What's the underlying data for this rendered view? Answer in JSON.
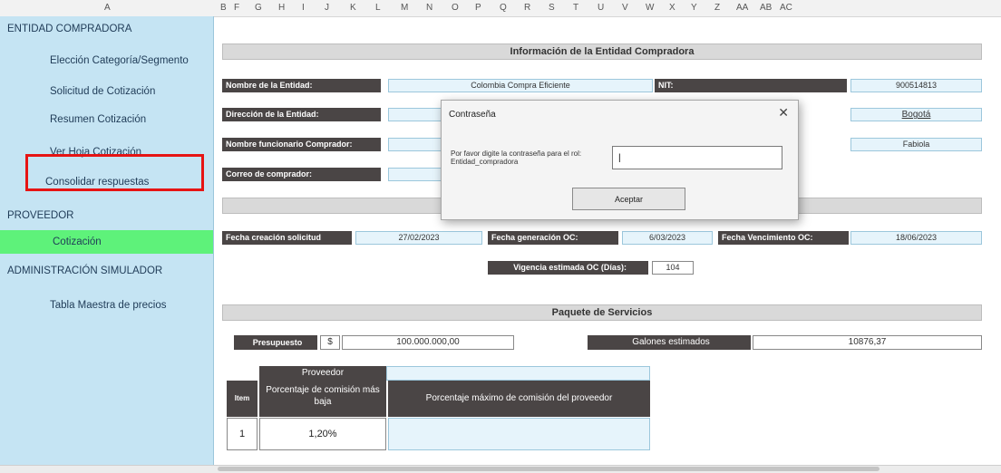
{
  "columns": [
    "A",
    "B",
    "F",
    "G",
    "H",
    "I",
    "J",
    "K",
    "L",
    "M",
    "N",
    "O",
    "P",
    "Q",
    "R",
    "S",
    "T",
    "U",
    "V",
    "W",
    "X",
    "Y",
    "Z",
    "AA",
    "AB",
    "AC"
  ],
  "sidebar": {
    "sections": [
      {
        "title": "ENTIDAD COMPRADORA"
      },
      {
        "title": "PROVEEDOR"
      },
      {
        "title": "ADMINISTRACIÓN SIMULADOR"
      }
    ],
    "items": [
      {
        "label": "Elección Categoría/Segmento"
      },
      {
        "label": "Solicitud de Cotización"
      },
      {
        "label": "Resumen Cotización"
      },
      {
        "label": "Ver Hoja Cotización"
      },
      {
        "label": "Consolidar respuestas"
      },
      {
        "label": "Cotización"
      },
      {
        "label": "Tabla Maestra de precios"
      }
    ]
  },
  "main": {
    "header1": "Información de la Entidad Compradora",
    "nombre_entidad_label": "Nombre de la Entidad:",
    "nombre_entidad_value": "Colombia Compra Eficiente",
    "nit_label": "NIT:",
    "nit_value": "900514813",
    "direccion_label": "Dirección de la Entidad:",
    "ciudad_value": "Bogotá",
    "funcionario_label": "Nombre funcionario Comprador:",
    "funcionario_value": "Fabiola",
    "correo_label": "Correo de comprador:",
    "fecha_creacion_label": "Fecha creación solicitud",
    "fecha_creacion_value": "27/02/2023",
    "fecha_generacion_label": "Fecha generación OC:",
    "fecha_generacion_value": "6/03/2023",
    "fecha_venc_label": "Fecha Vencimiento OC:",
    "fecha_venc_value": "18/06/2023",
    "vigencia_label": "Vigencia estimada OC (Días):",
    "vigencia_value": "104",
    "header2": "Paquete de Servicios",
    "presupuesto_label": "Presupuesto",
    "currency": "$",
    "presupuesto_value": "100.000.000,00",
    "galones_label": "Galones estimados",
    "galones_value": "10876,37"
  },
  "table": {
    "proveedor_header": "Proveedor",
    "item_header": "Item",
    "comision_baja_header": "Porcentaje de comisión más baja",
    "comision_max_header": "Porcentaje máximo de comisión del proveedor",
    "rows": [
      {
        "item": "1",
        "comision": "1,20%"
      }
    ]
  },
  "dialog": {
    "title": "Contraseña",
    "message": "Por favor digite la contraseña para el rol: Entidad_compradora",
    "input_value": "|",
    "accept_label": "Aceptar"
  },
  "colors": {
    "sidebar_bg": "#c5e4f3",
    "active_item": "#5ef27a",
    "highlight_box": "#e61414",
    "label_dark": "#4a4545"
  }
}
